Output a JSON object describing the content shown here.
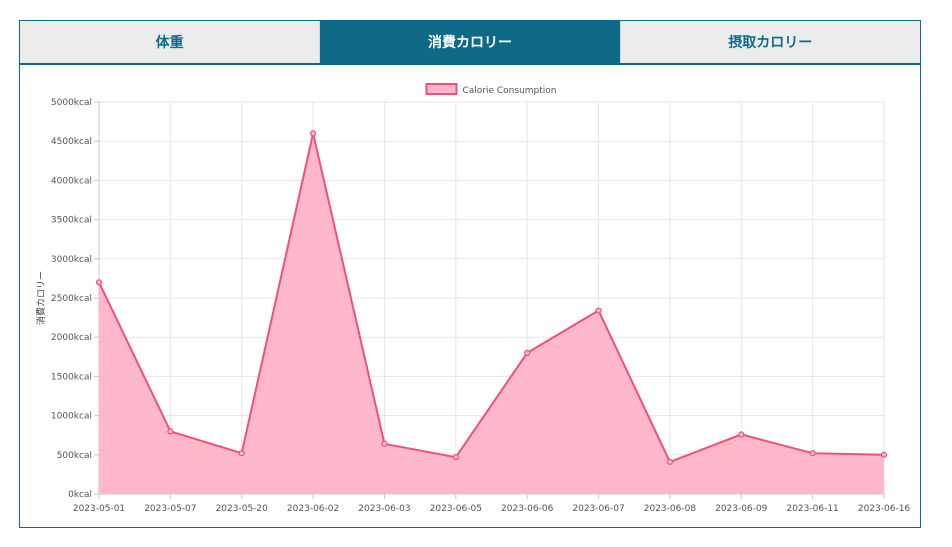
{
  "tabs": [
    {
      "label": "体重",
      "active": false
    },
    {
      "label": "消費カロリー",
      "active": true
    },
    {
      "label": "摂取カロリー",
      "active": false
    }
  ],
  "colors": {
    "accent": "#0e6a87",
    "series_stroke": "#f0507a",
    "series_fill": "#ffb8cb"
  },
  "chart_data": {
    "type": "area",
    "title": "",
    "xlabel": "",
    "ylabel": "消費カロリー",
    "unit": "kcal",
    "legend": {
      "label": "Calorie Consumption",
      "placement": "top-center"
    },
    "grid": true,
    "ylim": [
      0,
      5000
    ],
    "y_ticks": [
      "0kcal",
      "500kcal",
      "1000kcal",
      "1500kcal",
      "2000kcal",
      "2500kcal",
      "3000kcal",
      "3500kcal",
      "4000kcal",
      "4500kcal",
      "5000kcal"
    ],
    "categories": [
      "2023-05-01",
      "2023-05-07",
      "2023-05-20",
      "2023-06-02",
      "2023-06-03",
      "2023-06-05",
      "2023-06-06",
      "2023-06-07",
      "2023-06-08",
      "2023-06-09",
      "2023-06-11",
      "2023-06-16"
    ],
    "series": [
      {
        "name": "Calorie Consumption",
        "values": [
          2700,
          800,
          520,
          4600,
          640,
          470,
          1800,
          2340,
          410,
          760,
          520,
          500
        ]
      }
    ]
  }
}
